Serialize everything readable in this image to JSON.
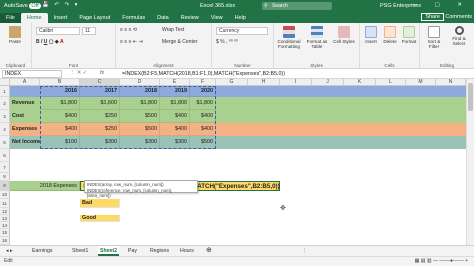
{
  "titlebar": {
    "autosave": "AutoSave",
    "autosave_state": "Off",
    "title": "Excel 365.xlsx",
    "search_placeholder": "Search",
    "user": "PSG Enterprises"
  },
  "tabs": [
    "File",
    "Home",
    "Insert",
    "Page Layout",
    "Formulas",
    "Data",
    "Review",
    "View",
    "Help"
  ],
  "active_tab": "Home",
  "share": "Share",
  "comments": "Comments",
  "ribbon": {
    "clipboard": {
      "label": "Clipboard",
      "paste": "Paste"
    },
    "font": {
      "label": "Font",
      "name": "Calibri",
      "size": "11"
    },
    "alignment": {
      "label": "Alignment",
      "wrap": "Wrap Text",
      "merge": "Merge & Center"
    },
    "number": {
      "label": "Number",
      "format": "Currency"
    },
    "styles": {
      "label": "Styles",
      "cond": "Conditional Formatting",
      "table": "Format as Table",
      "cell": "Cell Styles"
    },
    "cells": {
      "label": "Cells",
      "insert": "Insert",
      "delete": "Delete",
      "format": "Format"
    },
    "editing": {
      "label": "Editing",
      "sum": "Sort & Filter",
      "find": "Find & Select"
    }
  },
  "formula_bar": {
    "name_box": "INDEX",
    "fx": "fx",
    "formula": "=INDEX(B2:F5,MATCH(2018,B1:F1,0),MATCH(\"Expenses\",B2:B5,0))"
  },
  "columns": [
    "A",
    "B",
    "C",
    "D",
    "E",
    "F",
    "G",
    "H",
    "I",
    "J",
    "K",
    "L",
    "M",
    "N"
  ],
  "rows": [
    "1",
    "2",
    "3",
    "4",
    "5",
    "6",
    "7",
    "8",
    "9",
    "10",
    "11",
    "12",
    "13",
    "14",
    "15",
    "16",
    "17",
    "18",
    "19",
    "20"
  ],
  "sheet": {
    "years": [
      "2016",
      "2017",
      "2018",
      "2019",
      "2020"
    ],
    "labels": [
      "Revenue",
      "Cost",
      "Expenses",
      "Net Income"
    ],
    "values": [
      [
        "$1,800",
        "$1,600",
        "$1,800",
        "$1,800",
        "$1,800"
      ],
      [
        "$400",
        "$250",
        "$500",
        "$400",
        "$400"
      ],
      [
        "$400",
        "$250",
        "$500",
        "$400",
        "$400"
      ],
      [
        "$100",
        "$300",
        "$300",
        "$300",
        "$500"
      ]
    ],
    "a9": "2018 Expenses",
    "c9_formula": "=INDEX(B2:F5,MATCH(2018,B1:F1,0),MATCH(\"Expenses\",B2:B5,0))",
    "bad": "Bad",
    "good": "Good"
  },
  "tooltip": {
    "line1": "INDEX(array, row_num, [column_num])",
    "line2": "INDEX(reference, row_num, [column_num], [area_num])"
  },
  "sheet_tabs": [
    "Earnings",
    "Sheet1",
    "Sheet2",
    "Pay",
    "Regions",
    "Hours"
  ],
  "active_sheet": "Sheet2",
  "status": "Edit",
  "colors": {
    "excel_green": "#217346",
    "row_blue": "#8ea9db",
    "row_green": "#a9d08e",
    "row_orange": "#f4b183",
    "row_teal": "#9bc2b6",
    "highlight_yellow": "#ffd966",
    "gold_cell": "#f4c542"
  }
}
